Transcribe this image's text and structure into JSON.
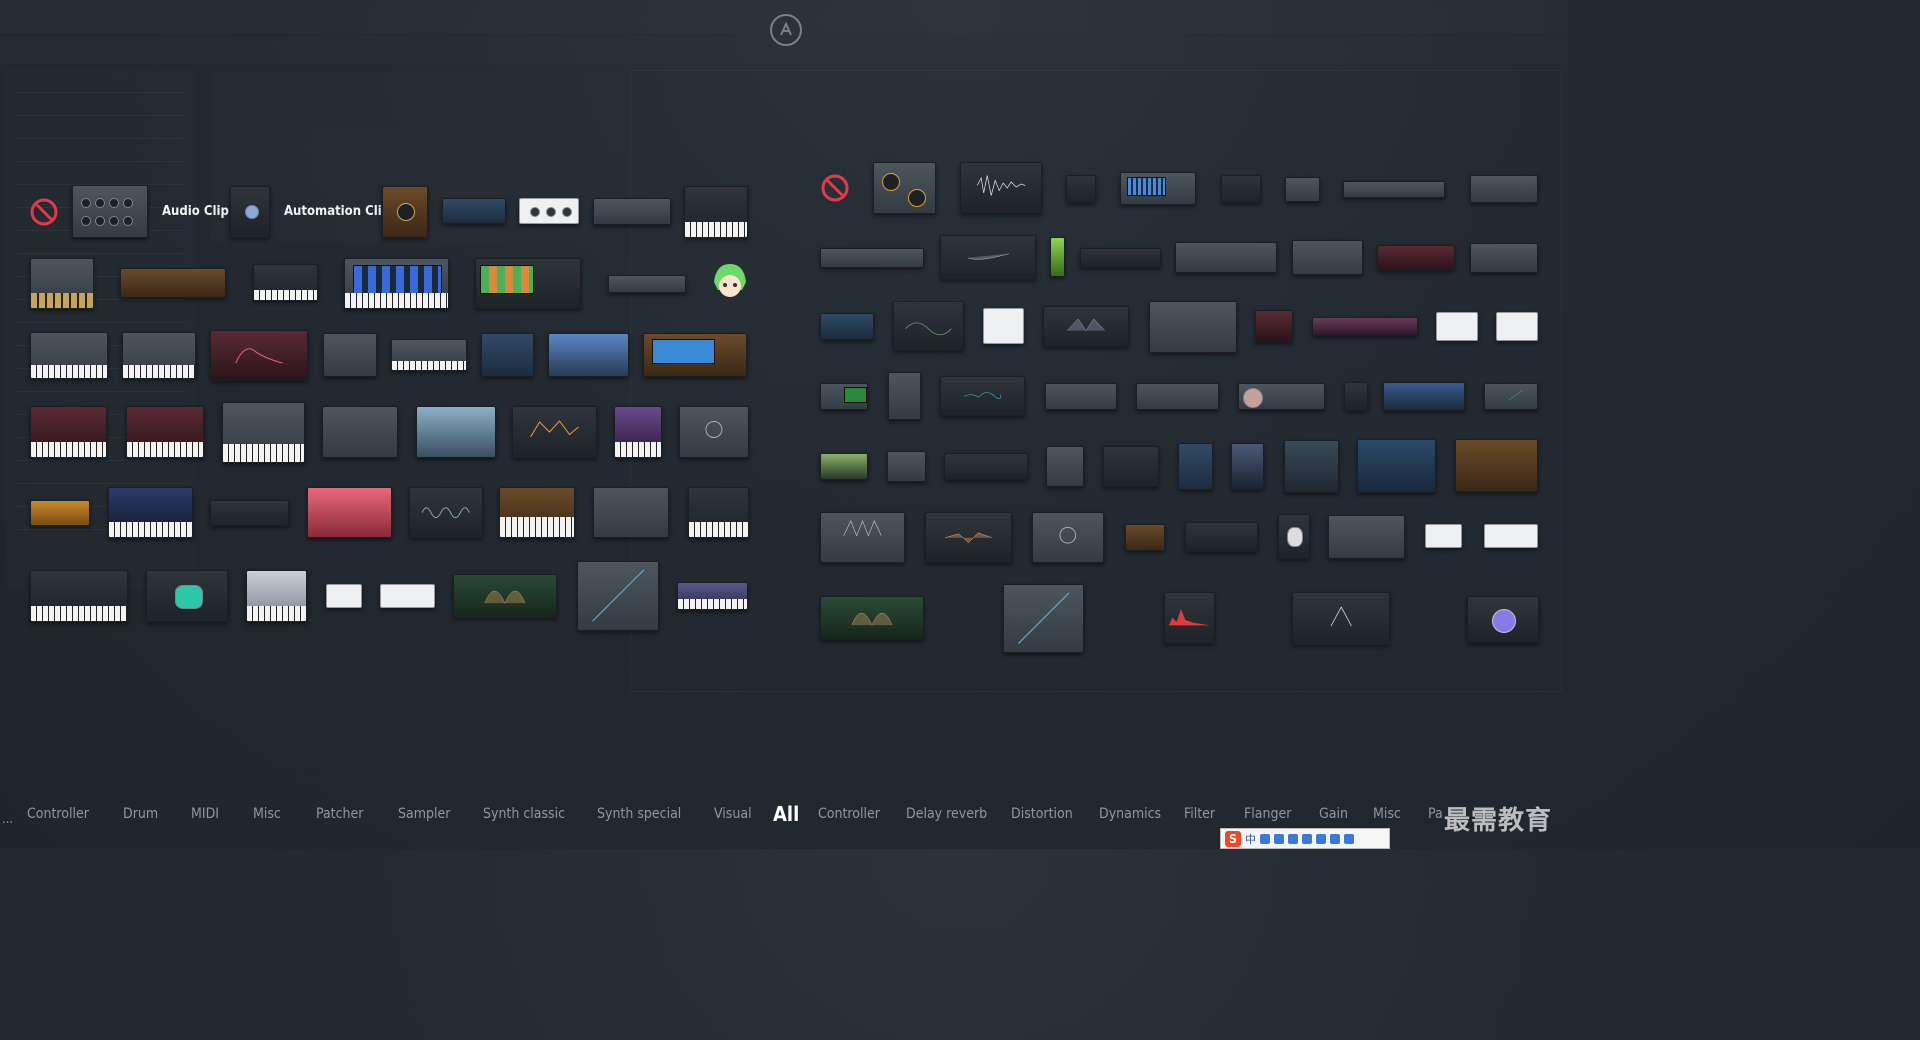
{
  "labels": {
    "audio_clip": "Audio Clip",
    "automation_clip": "Automation Clip"
  },
  "generator_categories": [
    "Controller",
    "Drum",
    "MIDI",
    "Misc",
    "Patcher",
    "Sampler",
    "Synth classic",
    "Synth special",
    "Visual"
  ],
  "selected_category": "All",
  "effect_categories": [
    "Controller",
    "Delay reverb",
    "Distortion",
    "Dynamics",
    "Filter",
    "Flanger",
    "Gain",
    "Misc",
    "Pa"
  ],
  "overflow_left": "...",
  "watermark": "最需教育",
  "ime": {
    "logo": "S",
    "lang": "中"
  },
  "colors": {
    "background": "#232a31",
    "selected": "#ffffff",
    "category": "#8f989f"
  }
}
